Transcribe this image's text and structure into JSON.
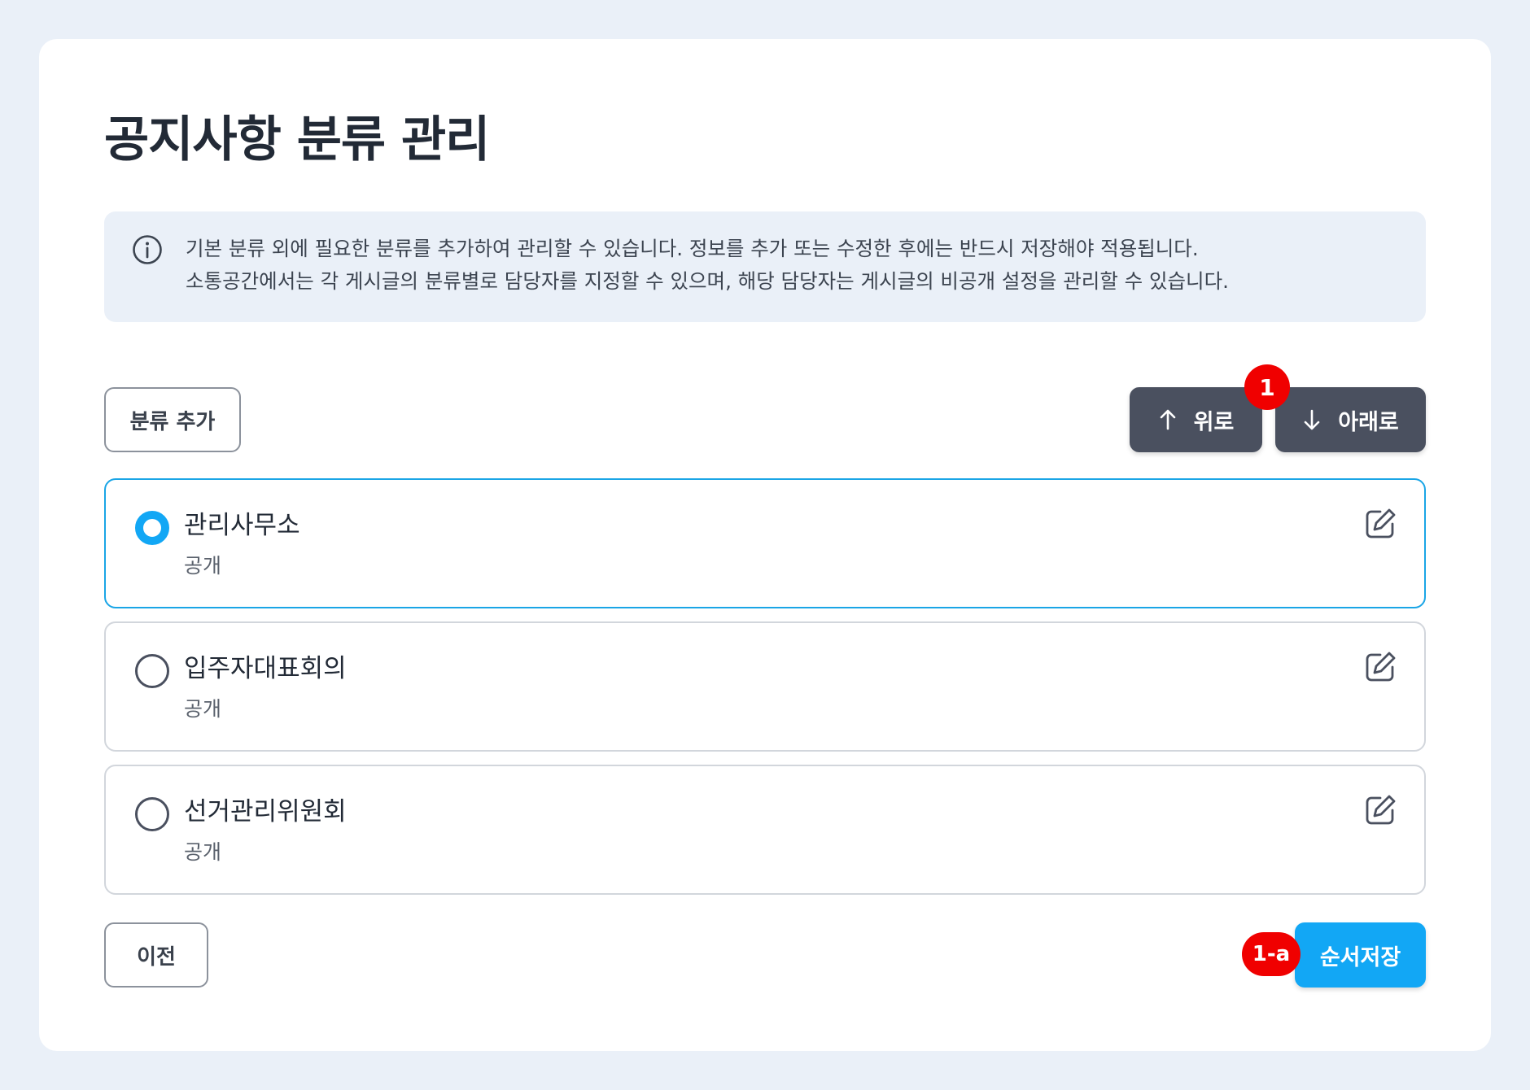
{
  "page": {
    "title": "공지사항 분류 관리"
  },
  "notice": {
    "icon": "info-icon",
    "line1": "기본 분류 외에 필요한 분류를 추가하여 관리할 수 있습니다. 정보를 추가 또는 수정한 후에는 반드시 저장해야 적용됩니다.",
    "line2": "소통공간에서는 각 게시글의 분류별로 담당자를 지정할 수 있으며, 해당 담당자는 게시글의 비공개 설정을 관리할 수 있습니다."
  },
  "toolbar": {
    "add_label": "분류 추가",
    "up_label": "위로",
    "down_label": "아래로",
    "up_icon": "arrow-up-icon",
    "down_icon": "arrow-down-icon",
    "badge_move": "1"
  },
  "categories": [
    {
      "name": "관리사무소",
      "status": "공개",
      "selected": true
    },
    {
      "name": "입주자대표회의",
      "status": "공개",
      "selected": false
    },
    {
      "name": "선거관리위원회",
      "status": "공개",
      "selected": false
    }
  ],
  "footer": {
    "prev_label": "이전",
    "save_label": "순서저장",
    "badge_save": "1-a"
  },
  "colors": {
    "accent": "#12a7f5",
    "dark_button": "#4a505f",
    "badge": "#f00000",
    "background": "#eaf0f8",
    "selected_border": "#1aa5e6"
  }
}
